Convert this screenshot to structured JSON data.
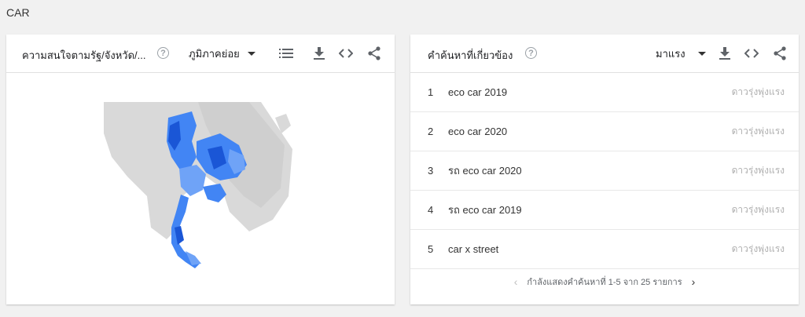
{
  "page": {
    "title": "CAR"
  },
  "left_card": {
    "title": "ความสนใจตามรัฐ/จังหวัด/...",
    "help": "?",
    "region_dropdown": "ภูมิภาคย่อย",
    "icons": [
      "help-icon",
      "list-icon",
      "download-icon",
      "embed-icon",
      "share-icon"
    ]
  },
  "right_card": {
    "title": "คำค้นหาที่เกี่ยวข้อง",
    "help": "?",
    "sort_dropdown": "มาแรง",
    "rows": [
      {
        "rank": "1",
        "query": "eco car 2019",
        "trend": "ดาวรุ่งพุ่งแรง"
      },
      {
        "rank": "2",
        "query": "eco car 2020",
        "trend": "ดาวรุ่งพุ่งแรง"
      },
      {
        "rank": "3",
        "query": "รถ eco car 2020",
        "trend": "ดาวรุ่งพุ่งแรง"
      },
      {
        "rank": "4",
        "query": "รถ eco car 2019",
        "trend": "ดาวรุ่งพุ่งแรง"
      },
      {
        "rank": "5",
        "query": "car x street",
        "trend": "ดาวรุ่งพุ่งแรง"
      }
    ],
    "pager": {
      "text": "กำลังแสดงคำค้นหาที่ 1-5 จาก 25 รายการ",
      "prev": "‹",
      "next": "›"
    }
  },
  "colors": {
    "map_land": "#d9d9d9",
    "map_blue": "#4285f4",
    "map_dark_blue": "#1a56d6",
    "map_light_blue": "#6fa3f7"
  }
}
